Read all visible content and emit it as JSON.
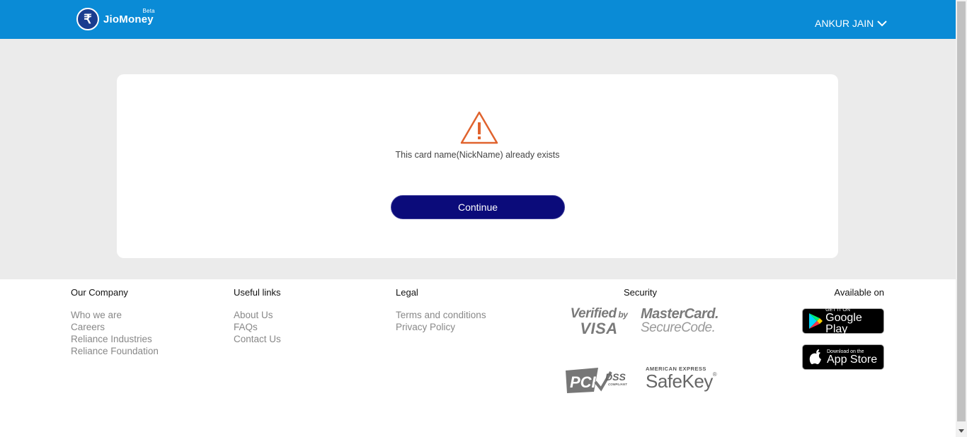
{
  "header": {
    "brand_symbol": "₹",
    "brand_name": "JioMoney",
    "brand_badge": "Beta",
    "user_name": "ANKUR JAIN"
  },
  "dialog": {
    "message": "This card name(NickName) already exists",
    "continue_label": "Continue"
  },
  "footer": {
    "company": {
      "title": "Our Company",
      "links": [
        "Who we are",
        "Careers",
        "Reliance Industries",
        "Reliance Foundation"
      ]
    },
    "useful": {
      "title": "Useful links",
      "links": [
        "About Us",
        "FAQs",
        "Contact Us"
      ]
    },
    "legal": {
      "title": "Legal",
      "links": [
        "Terms and conditions",
        "Privacy Policy"
      ]
    },
    "security": {
      "title": "Security"
    },
    "available": {
      "title": "Available on"
    }
  },
  "icons": {
    "warning": "warning-triangle-icon",
    "chevron": "chevron-down-icon"
  },
  "colors": {
    "header_bg": "#0a8bd6",
    "button_bg": "#0b0b7a",
    "warning": "#e0632e",
    "page_bg": "#ebebeb"
  }
}
